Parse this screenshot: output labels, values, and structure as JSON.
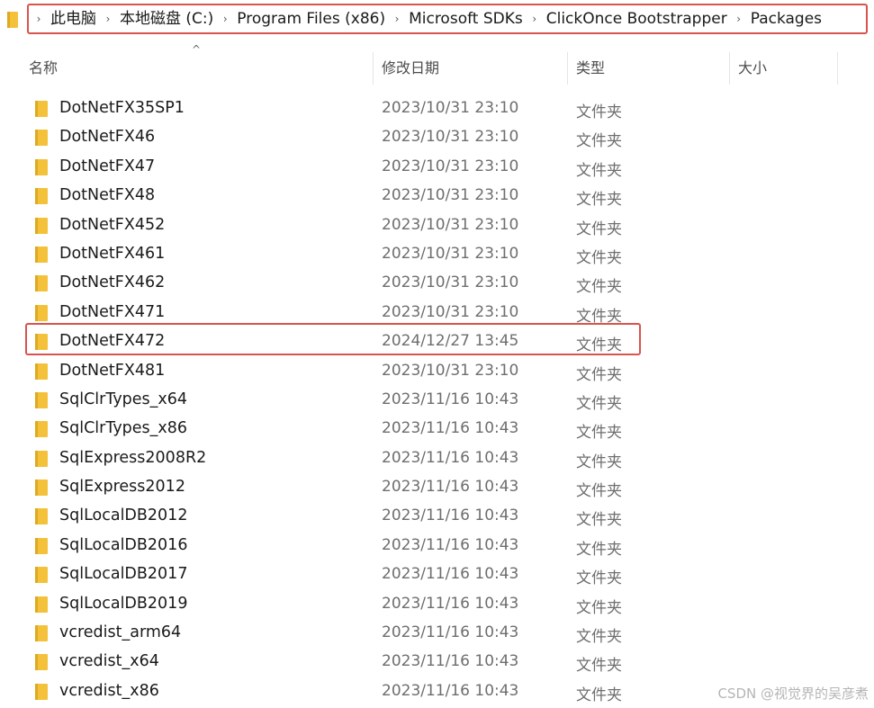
{
  "breadcrumb": [
    "此电脑",
    "本地磁盘 (C:)",
    "Program Files (x86)",
    "Microsoft SDKs",
    "ClickOnce Bootstrapper",
    "Packages"
  ],
  "columns": {
    "name": "名称",
    "date_modified": "修改日期",
    "type": "类型",
    "size": "大小"
  },
  "rows": [
    {
      "name": "DotNetFX35SP1",
      "date": "2023/10/31 23:10",
      "type": "文件夹"
    },
    {
      "name": "DotNetFX46",
      "date": "2023/10/31 23:10",
      "type": "文件夹"
    },
    {
      "name": "DotNetFX47",
      "date": "2023/10/31 23:10",
      "type": "文件夹"
    },
    {
      "name": "DotNetFX48",
      "date": "2023/10/31 23:10",
      "type": "文件夹"
    },
    {
      "name": "DotNetFX452",
      "date": "2023/10/31 23:10",
      "type": "文件夹"
    },
    {
      "name": "DotNetFX461",
      "date": "2023/10/31 23:10",
      "type": "文件夹"
    },
    {
      "name": "DotNetFX462",
      "date": "2023/10/31 23:10",
      "type": "文件夹"
    },
    {
      "name": "DotNetFX471",
      "date": "2023/10/31 23:10",
      "type": "文件夹"
    },
    {
      "name": "DotNetFX472",
      "date": "2024/12/27 13:45",
      "type": "文件夹"
    },
    {
      "name": "DotNetFX481",
      "date": "2023/10/31 23:10",
      "type": "文件夹"
    },
    {
      "name": "SqlClrTypes_x64",
      "date": "2023/11/16 10:43",
      "type": "文件夹"
    },
    {
      "name": "SqlClrTypes_x86",
      "date": "2023/11/16 10:43",
      "type": "文件夹"
    },
    {
      "name": "SqlExpress2008R2",
      "date": "2023/11/16 10:43",
      "type": "文件夹"
    },
    {
      "name": "SqlExpress2012",
      "date": "2023/11/16 10:43",
      "type": "文件夹"
    },
    {
      "name": "SqlLocalDB2012",
      "date": "2023/11/16 10:43",
      "type": "文件夹"
    },
    {
      "name": "SqlLocalDB2016",
      "date": "2023/11/16 10:43",
      "type": "文件夹"
    },
    {
      "name": "SqlLocalDB2017",
      "date": "2023/11/16 10:43",
      "type": "文件夹"
    },
    {
      "name": "SqlLocalDB2019",
      "date": "2023/11/16 10:43",
      "type": "文件夹"
    },
    {
      "name": "vcredist_arm64",
      "date": "2023/11/16 10:43",
      "type": "文件夹"
    },
    {
      "name": "vcredist_x64",
      "date": "2023/11/16 10:43",
      "type": "文件夹"
    },
    {
      "name": "vcredist_x86",
      "date": "2023/11/16 10:43",
      "type": "文件夹"
    }
  ],
  "watermark": "CSDN @视觉界的吴彦煮",
  "colors": {
    "highlight_border": "#d9534f",
    "folder_yellow": "#f3c13a"
  }
}
